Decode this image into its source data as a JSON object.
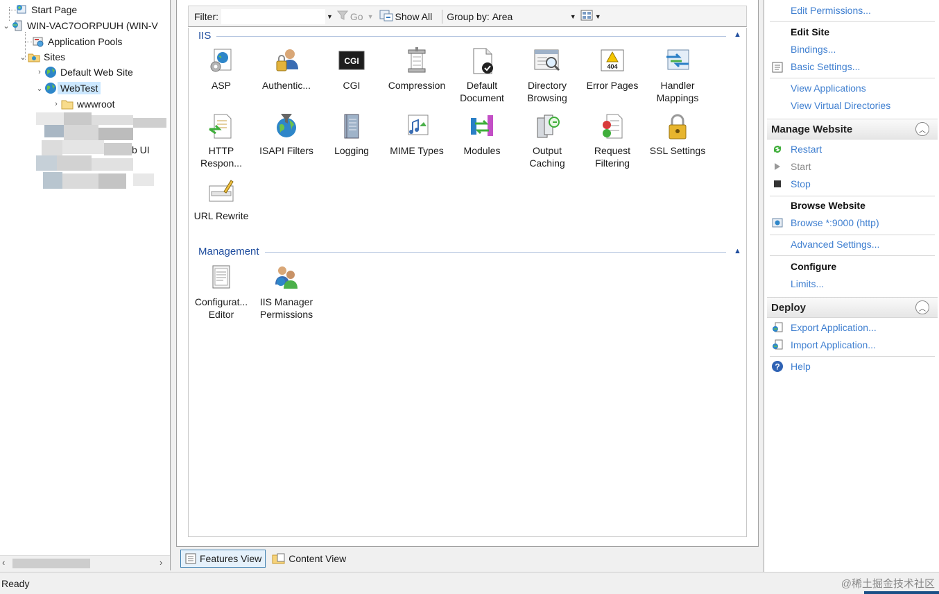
{
  "tree": {
    "start_page": "Start Page",
    "server": "WIN-VAC7OORPUUH (WIN-V",
    "app_pools": "Application Pools",
    "sites": "Sites",
    "default_site": "Default Web Site",
    "webtest": "WebTest",
    "wwwroot": "wwwroot",
    "obscured_fragment": "b UI"
  },
  "toolbar": {
    "filter_label": "Filter:",
    "go_label": "Go",
    "show_all_label": "Show All",
    "group_by_label": "Group by:",
    "group_by_value": "Area"
  },
  "groups": {
    "iis": "IIS",
    "management": "Management"
  },
  "features": {
    "asp": "ASP",
    "authentication": "Authentic...",
    "cgi": "CGI",
    "cgi_icon_text": "CGI",
    "compression": "Compression",
    "default_document_1": "Default",
    "default_document_2": "Document",
    "directory_browsing_1": "Directory",
    "directory_browsing_2": "Browsing",
    "error_pages": "Error Pages",
    "error_pages_icon_text": "404",
    "handler_mappings_1": "Handler",
    "handler_mappings_2": "Mappings",
    "http_response_1": "HTTP",
    "http_response_2": "Respon...",
    "isapi_filters": "ISAPI Filters",
    "logging": "Logging",
    "mime_types": "MIME Types",
    "modules": "Modules",
    "output_caching_1": "Output",
    "output_caching_2": "Caching",
    "request_filtering_1": "Request",
    "request_filtering_2": "Filtering",
    "ssl_settings": "SSL Settings",
    "url_rewrite": "URL Rewrite",
    "config_editor_1": "Configurat...",
    "config_editor_2": "Editor",
    "iis_mgr_perms_1": "IIS Manager",
    "iis_mgr_perms_2": "Permissions"
  },
  "views": {
    "features_view": "Features View",
    "content_view": "Content View"
  },
  "actions": {
    "edit_permissions": "Edit Permissions...",
    "edit_site": "Edit Site",
    "bindings": "Bindings...",
    "basic_settings": "Basic Settings...",
    "view_applications": "View Applications",
    "view_virtual_dirs": "View Virtual Directories",
    "manage_website": "Manage Website",
    "restart": "Restart",
    "start": "Start",
    "stop": "Stop",
    "browse_website": "Browse Website",
    "browse_9000": "Browse *:9000 (http)",
    "advanced_settings": "Advanced Settings...",
    "configure": "Configure",
    "limits": "Limits...",
    "deploy": "Deploy",
    "export_app": "Export Application...",
    "import_app": "Import Application...",
    "help": "Help"
  },
  "status": {
    "text": "Ready",
    "watermark": "@稀土掘金技术社区"
  },
  "colors": {
    "link": "#3f7fd0",
    "group_header": "#1f4d9e",
    "selection": "#cce8ff"
  }
}
